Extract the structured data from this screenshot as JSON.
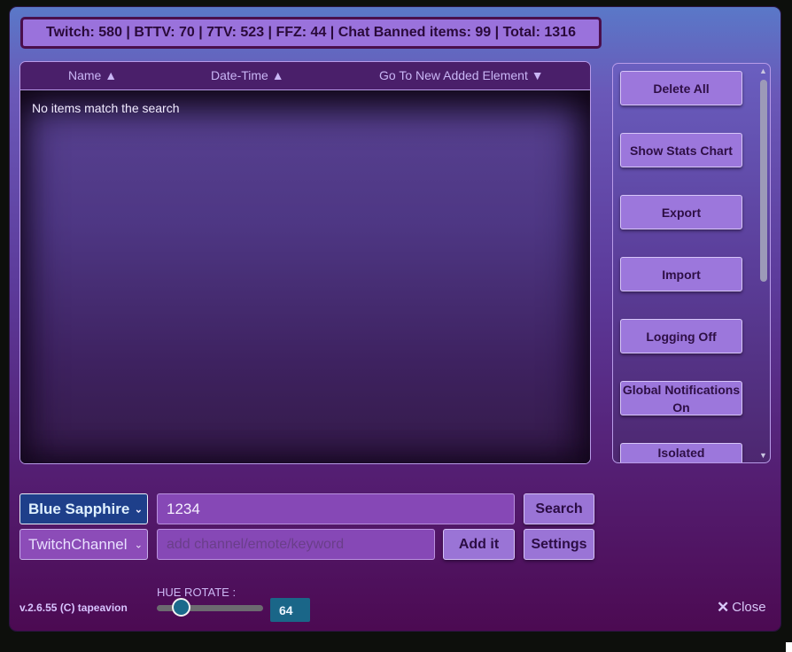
{
  "stats_bar": {
    "text": "Twitch: 580 | BTTV: 70 | 7TV: 523 | FFZ: 44 | Chat Banned items: 99 | Total: 1316"
  },
  "list": {
    "headers": {
      "name": "Name ▲",
      "datetime": "Date-Time ▲",
      "go_to_new": "Go To New Added Element ▼"
    },
    "empty_message": "No items match the search"
  },
  "sidebar": {
    "buttons": [
      {
        "label": "Delete All"
      },
      {
        "label": "Show Stats Chart"
      },
      {
        "label": "Export"
      },
      {
        "label": "Import"
      },
      {
        "label": "Logging Off"
      },
      {
        "label": "Global Notifications On"
      },
      {
        "label": "Isolated"
      }
    ]
  },
  "controls": {
    "theme_select": {
      "selected": "Blue Sapphire"
    },
    "search_input": {
      "value": "1234"
    },
    "search_button": "Search",
    "type_select": {
      "selected": "TwitchChannel"
    },
    "add_input": {
      "placeholder": "add channel/emote/keyword"
    },
    "add_button": "Add it",
    "settings_button": "Settings"
  },
  "footer": {
    "version": "v.2.6.55 (C) tapeavion",
    "hue_label": "HUE ROTATE :",
    "hue_value": "64",
    "close_label": "Close",
    "close_icon": "x-icon"
  },
  "colors": {
    "accent_button": "#9a74d6",
    "field_bg": "#8648b6",
    "hue_badge": "#1a6688",
    "panel_top": "#5a78c8",
    "panel_bottom": "#4c0a52"
  }
}
